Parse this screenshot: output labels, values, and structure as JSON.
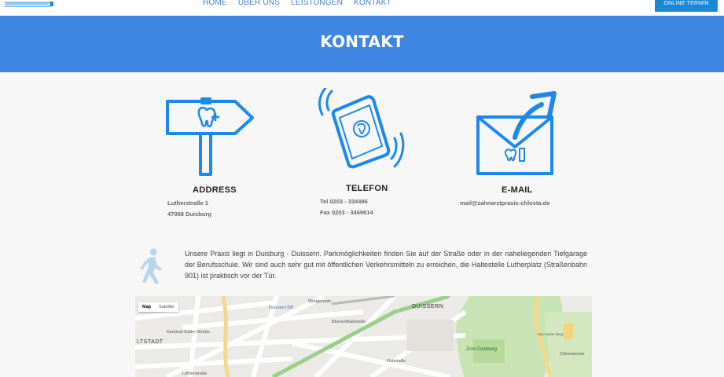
{
  "header": {
    "nav": [
      "HOME",
      "ÜBER UNS",
      "LEISTUNGEN",
      "KONTAKT"
    ],
    "cta": "ONLINE TERMIN"
  },
  "banner": {
    "title": "KONTAKT"
  },
  "contact": {
    "address": {
      "title": "ADDRESS",
      "line1": "Lutherstraße 1",
      "line2": "47058 Duisburg"
    },
    "phone": {
      "title": "TELEFON",
      "tel": "Tel  0203 - 334496",
      "fax": "Fax 0203 - 3469814"
    },
    "email": {
      "title": "E-MAIL",
      "value": "mail@zahnarztpraxis-chlosta.de"
    }
  },
  "intro": "Unsere Praxis liegt in Duisburg - Duissern. Parkmöglichkeiten finden Sie auf der Straße oder in der naheliegenden Tiefgarage der Berufsschule. Wir sind auch sehr gut mit öffentlichen Verkehrsmitteln zu erreichen, die Haltestelle Lutherplatz (Straßenbahn 901) ist praktisch vor der Tür.",
  "map": {
    "tabs": [
      "Map",
      "Satellite"
    ],
    "labels": {
      "duissern": "DUISSERN",
      "altstadt": "LTSTADT",
      "zoo": "Zoo Duisburg",
      "chines": "Chinesischer",
      "duissern_stop": "Duissern DB",
      "lutherstr": "Lutherstraße",
      "kardinal": "Kardinal-Galen-Straße",
      "wintgens": "Wintgensstr.",
      "blumenthal": "Blumenthalstraße",
      "oststr": "Oststraße",
      "zoo_label": "Zoo Kaiser Berg"
    }
  },
  "colors": {
    "accent": "#3f86e3",
    "icon": "#1b88ee"
  }
}
